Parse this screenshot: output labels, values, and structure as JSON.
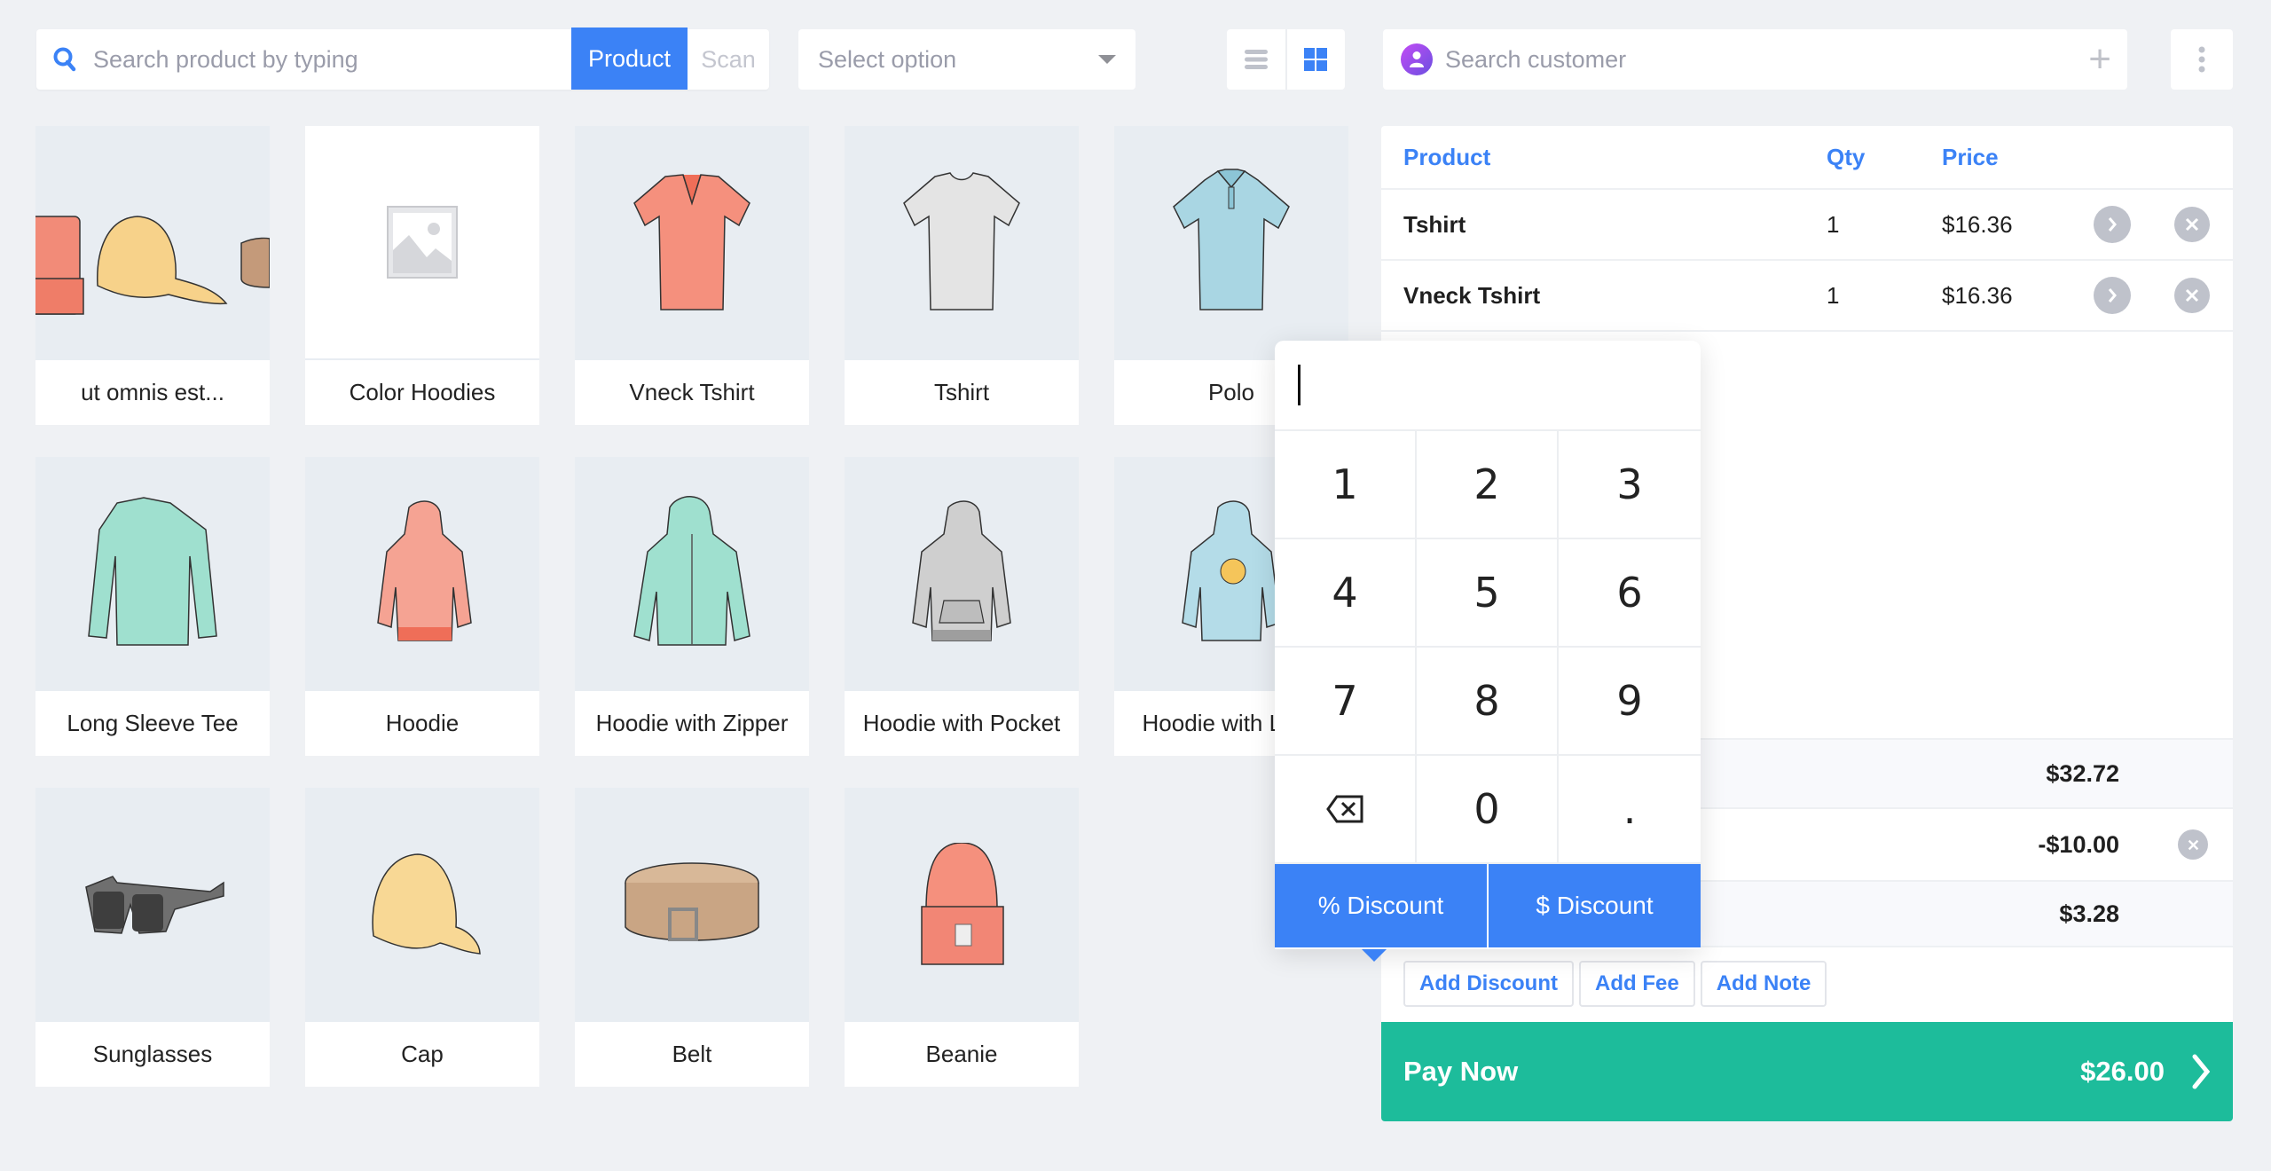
{
  "search": {
    "placeholder": "Search product by typing",
    "mode_product": "Product",
    "mode_scan": "Scan",
    "active_mode": "Product"
  },
  "filter": {
    "selected": "Select option"
  },
  "view_toggle": {
    "options": [
      "list",
      "grid"
    ],
    "active": "grid"
  },
  "customer": {
    "placeholder": "Search customer"
  },
  "colors": {
    "accent": "#3b82f6",
    "pay": "#1dbc9b",
    "background": "#eff1f4",
    "muted_icon": "#bfc2cb"
  },
  "products": [
    {
      "name": "ut omnis est...",
      "image": "beanie-cap-belt-bundle"
    },
    {
      "name": "Color Hoodies",
      "image": "placeholder"
    },
    {
      "name": "Vneck Tshirt",
      "image": "vneck-tshirt-coral"
    },
    {
      "name": "Tshirt",
      "image": "tshirt-grey"
    },
    {
      "name": "Polo",
      "image": "polo-blue"
    },
    {
      "name": "Long Sleeve Tee",
      "image": "long-sleeve-mint"
    },
    {
      "name": "Hoodie",
      "image": "hoodie-coral"
    },
    {
      "name": "Hoodie with Zipper",
      "image": "hoodie-zipper-mint"
    },
    {
      "name": "Hoodie with Pocket",
      "image": "hoodie-pocket-grey"
    },
    {
      "name": "Hoodie with Logo",
      "image": "hoodie-logo-blue"
    },
    {
      "name": "Sunglasses",
      "image": "sunglasses"
    },
    {
      "name": "Cap",
      "image": "cap-yellow"
    },
    {
      "name": "Belt",
      "image": "belt-brown"
    },
    {
      "name": "Beanie",
      "image": "beanie-coral"
    }
  ],
  "cart": {
    "headers": {
      "product": "Product",
      "qty": "Qty",
      "price": "Price"
    },
    "items": [
      {
        "name": "Tshirt",
        "qty": "1",
        "price": "$16.36"
      },
      {
        "name": "Vneck Tshirt",
        "qty": "1",
        "price": "$16.36"
      }
    ],
    "totals": {
      "subtotal": "$32.72",
      "discount": "-$10.00",
      "tax": "$3.28"
    },
    "actions": {
      "add_discount": "Add Discount",
      "add_fee": "Add Fee",
      "add_note": "Add Note"
    },
    "pay_now": {
      "label": "Pay Now",
      "amount": "$26.00"
    }
  },
  "numpad": {
    "value": "",
    "keys": [
      "1",
      "2",
      "3",
      "4",
      "5",
      "6",
      "7",
      "8",
      "9",
      "backspace",
      "0",
      "."
    ],
    "percent_discount": "% Discount",
    "fixed_discount": "$ Discount"
  }
}
